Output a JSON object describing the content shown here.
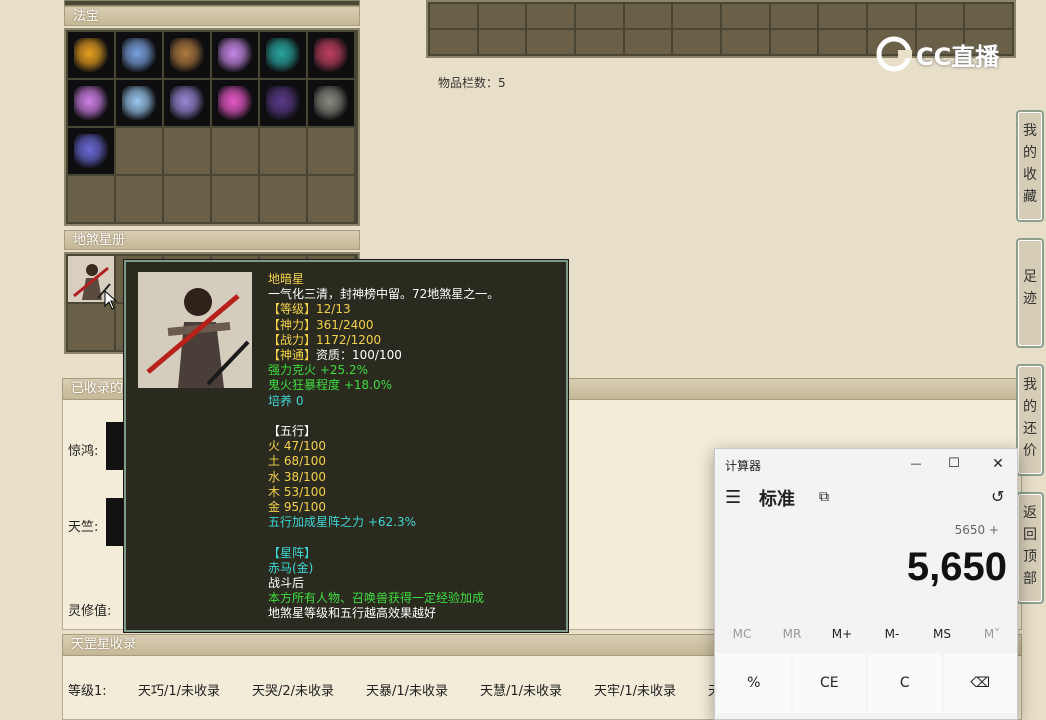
{
  "fabao": {
    "header": "法宝",
    "item_names": [
      "gold-orb-item",
      "crystal-claw-item",
      "lute-item",
      "lantern-item",
      "teal-gourd-item",
      "scroll-item",
      "purple-ring-item",
      "ice-claw-item",
      "violet-sword-item",
      "pink-lantern-item",
      "dark-orb-item",
      "stone-tablet-item",
      "blue-cloth-item"
    ],
    "item_colors": [
      "#e8a020",
      "#7aa2e0",
      "#b07a40",
      "#c888e8",
      "#2aa6a0",
      "#c04060",
      "#d080e8",
      "#9ac8f0",
      "#9a88d8",
      "#e858c8",
      "#5a3a8a",
      "#8a8a80",
      "#6a6ad8"
    ]
  },
  "disha": {
    "header": "地煞星册"
  },
  "inventory": {
    "count_label": "物品栏数：5"
  },
  "collected": {
    "header_partial": "已收录的",
    "row1_label": "惊鸿:",
    "row2_label": "天竺:",
    "row3_label": "灵修值:"
  },
  "tiangang": {
    "header": "天罡星收录",
    "level_label": "等级1:",
    "items": [
      "天巧/1/未收录",
      "天哭/2/未收录",
      "天暴/1/未收录",
      "天慧/1/未收录",
      "天牢/1/未收录"
    ],
    "trailing_partial": "天"
  },
  "tooltip": {
    "name": "地暗星",
    "desc": "一气化三清，封神榜中留。72地煞星之一。",
    "level_key": "【等级】",
    "level_val": "12/13",
    "shen_key": "【神力】",
    "shen_val": "361/2400",
    "zhan_key": "【战力】",
    "zhan_val": "1172/1200",
    "tong_key": "【神通】",
    "tong_val": "资质：100/100",
    "bonus1": "强力克火 +25.2%",
    "bonus2": "鬼火狂暴程度 +18.0%",
    "peiyang": "培养 0",
    "wuxing_title": "【五行】",
    "wx_huo": "火 47/100",
    "wx_tu": "土 68/100",
    "wx_shui": "水 38/100",
    "wx_mu": "木 53/100",
    "wx_jin": "金 95/100",
    "wx_bonus": "五行加成星阵之力 +62.3%",
    "xingzhen_title": "【星阵】",
    "xz_name": "赤马(金)",
    "xz_trigger": "战斗后",
    "xz_effect": "本方所有人物、召唤兽获得一定经验加成",
    "xz_note": "地煞星等级和五行越高效果越好"
  },
  "side_tabs": {
    "favorites": "我的收藏",
    "footprint": "足迹",
    "bargain": "我的还价",
    "back_top": "返回顶部"
  },
  "watermark": {
    "text": "CC直播"
  },
  "calculator": {
    "title": "计算器",
    "mode": "标准",
    "expression": "5650 +",
    "display": "5,650",
    "memory": [
      "MC",
      "MR",
      "M+",
      "M-",
      "MS",
      "M˅"
    ],
    "keys": [
      "%",
      "CE",
      "C",
      "⌫"
    ],
    "minimize": "—",
    "maximize": "☐",
    "close": "✕",
    "menu_icon": "☰",
    "keep_on_top_icon": "⧉",
    "history_icon": "↺"
  }
}
